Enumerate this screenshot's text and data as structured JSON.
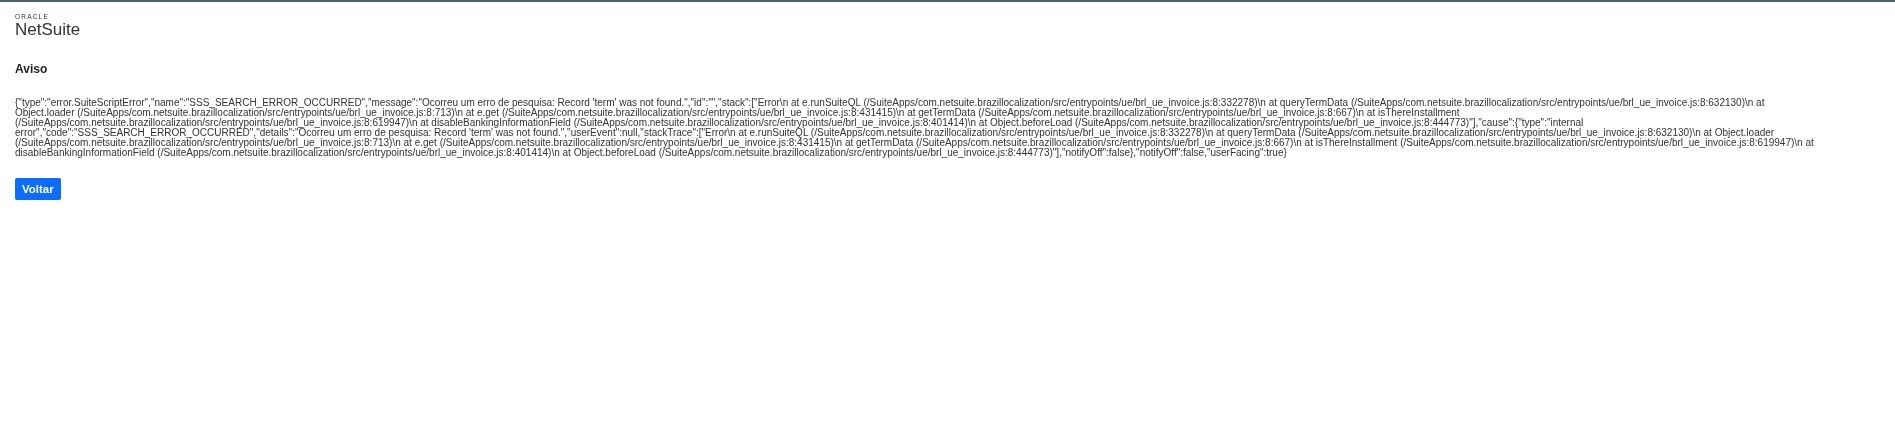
{
  "logo": {
    "company": "ORACLE",
    "product": "NetSuite"
  },
  "heading": "Aviso",
  "message": "{\"type\":\"error.SuiteScriptError\",\"name\":\"SSS_SEARCH_ERROR_OCCURRED\",\"message\":\"Ocorreu um erro de pesquisa: Record 'term' was not found.\",\"id\":\"\",\"stack\":[\"Error\\n at e.runSuiteQL (/SuiteApps/com.netsuite.brazillocalization/src/entrypoints/ue/brl_ue_invoice.js:8:332278)\\n at queryTermData (/SuiteApps/com.netsuite.brazillocalization/src/entrypoints/ue/brl_ue_invoice.js:8:632130)\\n at Object.loader (/SuiteApps/com.netsuite.brazillocalization/src/entrypoints/ue/brl_ue_invoice.js:8:713)\\n at e.get (/SuiteApps/com.netsuite.brazillocalization/src/entrypoints/ue/brl_ue_invoice.js:8:431415)\\n at getTermData (/SuiteApps/com.netsuite.brazillocalization/src/entrypoints/ue/brl_ue_invoice.js:8:667)\\n at isThereInstallment (/SuiteApps/com.netsuite.brazillocalization/src/entrypoints/ue/brl_ue_invoice.js:8:619947)\\n at disableBankingInformationField (/SuiteApps/com.netsuite.brazillocalization/src/entrypoints/ue/brl_ue_invoice.js:8:401414)\\n at Object.beforeLoad (/SuiteApps/com.netsuite.brazillocalization/src/entrypoints/ue/brl_ue_invoice.js:8:444773)\"],\"cause\":{\"type\":\"internal error\",\"code\":\"SSS_SEARCH_ERROR_OCCURRED\",\"details\":\"Ocorreu um erro de pesquisa: Record 'term' was not found.\",\"userEvent\":null,\"stackTrace\":[\"Error\\n at e.runSuiteQL (/SuiteApps/com.netsuite.brazillocalization/src/entrypoints/ue/brl_ue_invoice.js:8:332278)\\n at queryTermData (/SuiteApps/com.netsuite.brazillocalization/src/entrypoints/ue/brl_ue_invoice.js:8:632130)\\n at Object.loader (/SuiteApps/com.netsuite.brazillocalization/src/entrypoints/ue/brl_ue_invoice.js:8:713)\\n at e.get (/SuiteApps/com.netsuite.brazillocalization/src/entrypoints/ue/brl_ue_invoice.js:8:431415)\\n at getTermData (/SuiteApps/com.netsuite.brazillocalization/src/entrypoints/ue/brl_ue_invoice.js:8:667)\\n at isThereInstallment (/SuiteApps/com.netsuite.brazillocalization/src/entrypoints/ue/brl_ue_invoice.js:8:619947)\\n at disableBankingInformationField (/SuiteApps/com.netsuite.brazillocalization/src/entrypoints/ue/brl_ue_invoice.js:8:401414)\\n at Object.beforeLoad (/SuiteApps/com.netsuite.brazillocalization/src/entrypoints/ue/brl_ue_invoice.js:8:444773)\"],\"notifyOff\":false},\"notifyOff\":false,\"userFacing\":true}",
  "button": "Voltar"
}
